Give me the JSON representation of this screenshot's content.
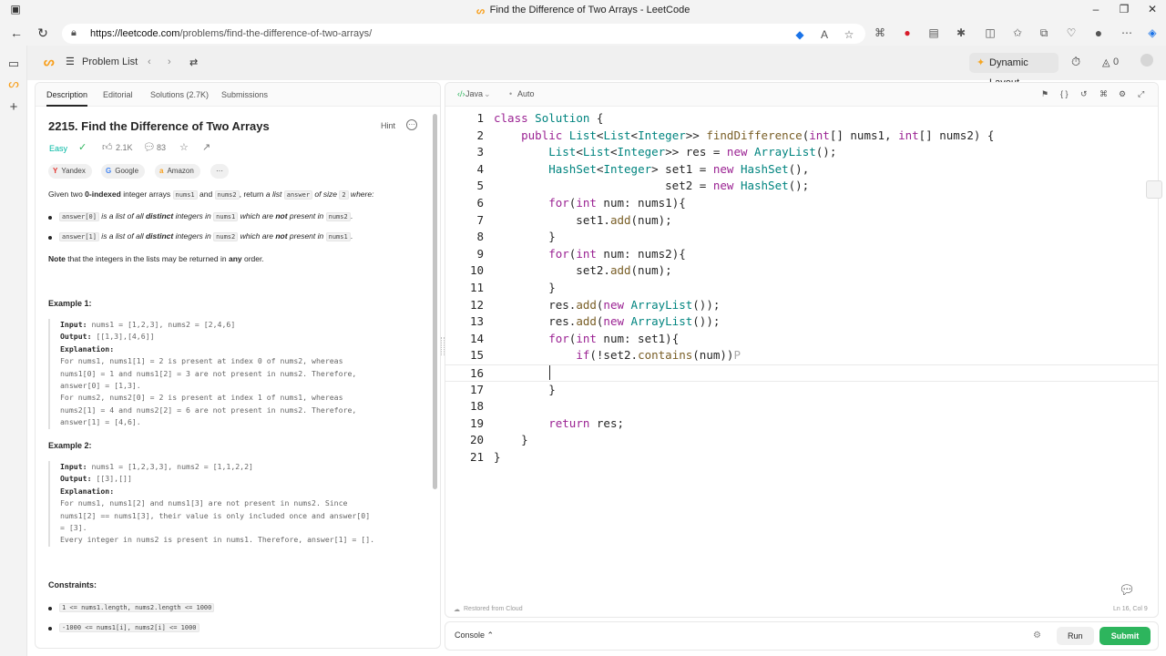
{
  "browser": {
    "tab_title": "Find the Difference of Two Arrays - LeetCode",
    "url_domain": "https://leetcode.com",
    "url_path": "/problems/find-the-difference-of-two-arrays/"
  },
  "nav": {
    "problem_list": "Problem List",
    "dynamic_layout": "Dynamic Layout",
    "streak_count": "0"
  },
  "tabs": {
    "description": "Description",
    "editorial": "Editorial",
    "solutions": "Solutions (2.7K)",
    "submissions": "Submissions"
  },
  "problem": {
    "title": "2215. Find the Difference of Two Arrays",
    "hint": "Hint",
    "difficulty": "Easy",
    "likes": "2.1K",
    "comments": "83",
    "companies": [
      "Yandex",
      "Google",
      "Amazon"
    ],
    "more_companies": "···"
  },
  "description": {
    "p1_a": "Given two ",
    "p1_b": "0-indexed",
    "p1_c": " integer arrays ",
    "p1_d": "nums1",
    "p1_e": " and ",
    "p1_f": "nums2",
    "p1_g": ", return ",
    "p1_h": "a list ",
    "p1_i": "answer",
    "p1_j": " of size ",
    "p1_k": "2",
    "p1_l": " where:",
    "b1_code": "answer[0]",
    "b1_a": " is a list of all ",
    "b1_b": "distinct",
    "b1_c": " integers in ",
    "b1_d": "nums1",
    "b1_e": " which are ",
    "b1_f": "not",
    "b1_g": " present in ",
    "b1_h": "nums2",
    "b1_i": ".",
    "b2_code": "answer[1]",
    "b2_a": " is a list of all ",
    "b2_b": "distinct",
    "b2_c": " integers in ",
    "b2_d": "nums2",
    "b2_e": " which are ",
    "b2_f": "not",
    "b2_g": " present in ",
    "b2_h": "nums1",
    "b2_i": ".",
    "note_a": "Note",
    "note_b": " that the integers in the lists may be returned in ",
    "note_c": "any",
    "note_d": " order."
  },
  "examples": [
    {
      "heading": "Example 1:",
      "input_label": "Input:",
      "input": " nums1 = [1,2,3], nums2 = [2,4,6]",
      "output_label": "Output:",
      "output": " [[1,3],[4,6]]",
      "expl_label": "Explanation:",
      "expl": [
        "For nums1, nums1[1] = 2 is present at index 0 of nums2, whereas",
        "nums1[0] = 1 and nums1[2] = 3 are not present in nums2. Therefore,",
        "answer[0] = [1,3].",
        "For nums2, nums2[0] = 2 is present at index 1 of nums1, whereas",
        "nums2[1] = 4 and nums2[2] = 6 are not present in nums2. Therefore,",
        "answer[1] = [4,6]."
      ]
    },
    {
      "heading": "Example 2:",
      "input_label": "Input:",
      "input": " nums1 = [1,2,3,3], nums2 = [1,1,2,2]",
      "output_label": "Output:",
      "output": " [[3],[]]",
      "expl_label": "Explanation:",
      "expl": [
        "For nums1, nums1[2] and nums1[3] are not present in nums2. Since",
        "nums1[2] == nums1[3], their value is only included once and answer[0]",
        "= [3].",
        "Every integer in nums2 is present in nums1. Therefore, answer[1] = []."
      ]
    }
  ],
  "constraints": {
    "heading": "Constraints:",
    "items": [
      "1 <= nums1.length, nums2.length <= 1000",
      "-1000 <= nums1[i], nums2[i] <= 1000"
    ]
  },
  "editor": {
    "language": "Java",
    "auto": "Auto",
    "restored": "Restored from Cloud",
    "cursor_pos": "Ln 16, Col 9",
    "line_numbers": [
      "1",
      "2",
      "3",
      "4",
      "5",
      "6",
      "7",
      "8",
      "9",
      "10",
      "11",
      "12",
      "13",
      "14",
      "15",
      "16",
      "17",
      "18",
      "19",
      "20",
      "21"
    ]
  },
  "console": {
    "console_label": "Console",
    "run": "Run",
    "submit": "Submit"
  }
}
